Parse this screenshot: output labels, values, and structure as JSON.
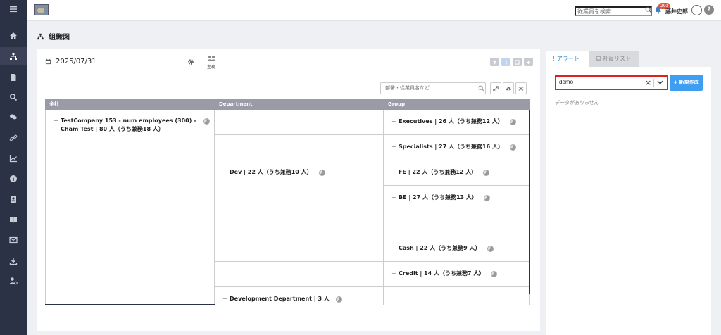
{
  "header": {
    "search_placeholder": "従業員を検索",
    "notification_count": "293",
    "user_name": "藤井史郎",
    "help_label": "?"
  },
  "sidebar": {
    "icons": [
      "menu-icon",
      "home-icon",
      "org-chart-icon",
      "document-icon",
      "search-icon",
      "chat-icon",
      "link-icon",
      "chart-icon",
      "info-icon",
      "contact-card-icon",
      "book-icon",
      "mail-icon",
      "download-icon",
      "user-settings-icon"
    ]
  },
  "page": {
    "title": "組織図"
  },
  "org_panel": {
    "date": "2025/07/31",
    "main_label": "主務",
    "member_search_placeholder": "部署・従業員名など",
    "columns": [
      "全社",
      "Department",
      "Group"
    ],
    "company_node": "TestCompany 153 - num employees (300) - Cham Test | 80 人（うち兼務18 人）",
    "departments": [
      {
        "label": "Dev | 22 人（うち兼務10 人）"
      },
      {
        "label": "Development Department | 3 人"
      }
    ],
    "groups": [
      {
        "label": "Executives | 26 人（うち兼務12 人）"
      },
      {
        "label": "Specialists | 27 人（うち兼務16 人）"
      },
      {
        "label": "FE | 22 人（うち兼務12 人）"
      },
      {
        "label": "BE | 27 人（うち兼務13 人）"
      },
      {
        "label": "Cash | 22 人（うち兼務9 人）"
      },
      {
        "label": "Credit | 14 人（うち兼務7 人）"
      }
    ]
  },
  "right_panel": {
    "tabs": [
      "! アラート",
      "社員リスト"
    ],
    "select_value": "demo",
    "new_button_label": "+ 新規作成",
    "empty_text": "データがありません"
  },
  "colors": {
    "sidebar_bg": "#2c3246",
    "accent": "#3d9ef2",
    "highlight_border": "#e02020",
    "grid_header": "#9a9ba7"
  }
}
